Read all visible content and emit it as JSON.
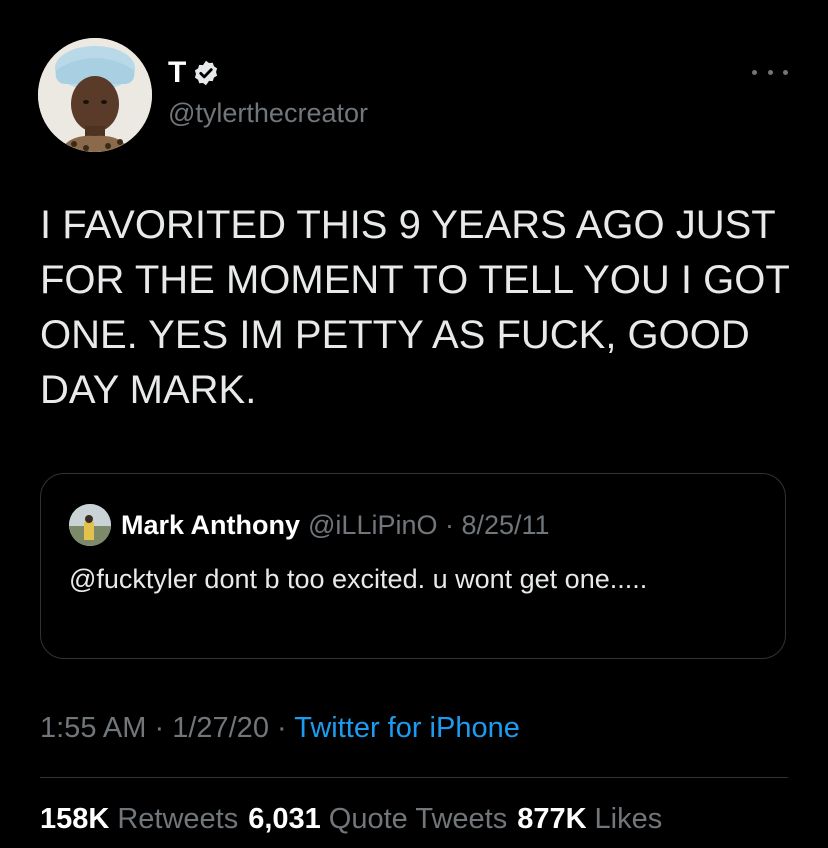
{
  "author": {
    "display_name": "T",
    "handle": "@tylerthecreator",
    "verified": true
  },
  "tweet": {
    "text": "I FAVORITED THIS 9 YEARS AGO JUST FOR THE MOMENT TO TELL YOU I GOT ONE. YES IM PETTY AS FUCK, GOOD DAY MARK."
  },
  "quoted_tweet": {
    "display_name": "Mark Anthony",
    "meta": "@iLLiPinO · 8/25/11",
    "text": "@fucktyler dont b too excited. u wont get one....."
  },
  "meta": {
    "time": "1:55 AM",
    "date": "1/27/20",
    "sep": " · ",
    "source": "Twitter for iPhone"
  },
  "stats": {
    "retweets_count": "158K",
    "retweets_label": "Retweets",
    "quotes_count": "6,031",
    "quotes_label": "Quote Tweets",
    "likes_count": "877K",
    "likes_label": "Likes"
  },
  "colors": {
    "background": "#000000",
    "text": "#e7e9ea",
    "secondary": "#71767b",
    "link": "#1d9bf0",
    "border": "#2f3336"
  },
  "icons": [
    "verified-badge-icon",
    "more-options-icon"
  ]
}
